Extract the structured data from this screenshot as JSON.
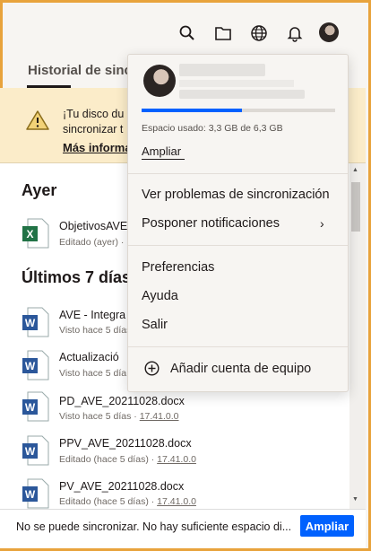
{
  "header": {
    "title": "Historial de sinc",
    "icons": [
      "search-icon",
      "folder-icon",
      "globe-icon",
      "bell-icon",
      "avatar"
    ]
  },
  "banner": {
    "line1": "¡Tu disco du",
    "line2": "sincronizar t",
    "link": "Más informa"
  },
  "list": {
    "sections": {
      "yesterday": "Ayer",
      "last7": "Últimos 7 días"
    },
    "files": [
      {
        "type": "excel",
        "name": "ObjetivosAVE",
        "meta": "Editado (ayer) · ",
        "version": ""
      },
      {
        "type": "word",
        "name": "AVE - Integra",
        "meta": "Visto hace 5 días",
        "version": ""
      },
      {
        "type": "word",
        "name": "Actualizació",
        "meta": "Visto hace 5 día",
        "version": ""
      },
      {
        "type": "word",
        "name": "PD_AVE_20211028.docx",
        "meta": "Visto hace 5 días · ",
        "version": "17.41.0.0"
      },
      {
        "type": "word",
        "name": "PPV_AVE_20211028.docx",
        "meta": "Editado (hace 5 días) · ",
        "version": "17.41.0.0"
      },
      {
        "type": "word",
        "name": "PV_AVE_20211028.docx",
        "meta": "Editado (hace 5 días) · ",
        "version": "17.41.0.0"
      }
    ]
  },
  "bottombar": {
    "message": "No se puede sincronizar. No hay suficiente espacio di...",
    "button": "Ampliar"
  },
  "menu": {
    "usage_text": "Espacio usado: 3,3 GB de 6,3 GB",
    "usage_fraction": 0.52,
    "ampliar": "Ampliar",
    "items": [
      "Ver problemas de sincronización",
      "Posponer notificaciones",
      "Preferencias",
      "Ayuda",
      "Salir",
      "Añadir cuenta de equipo"
    ]
  },
  "colors": {
    "accent": "#0061fe",
    "window_border": "#e8a33c",
    "banner_bg": "#fbecc9",
    "word_blue": "#2b579a",
    "excel_green": "#217346"
  }
}
